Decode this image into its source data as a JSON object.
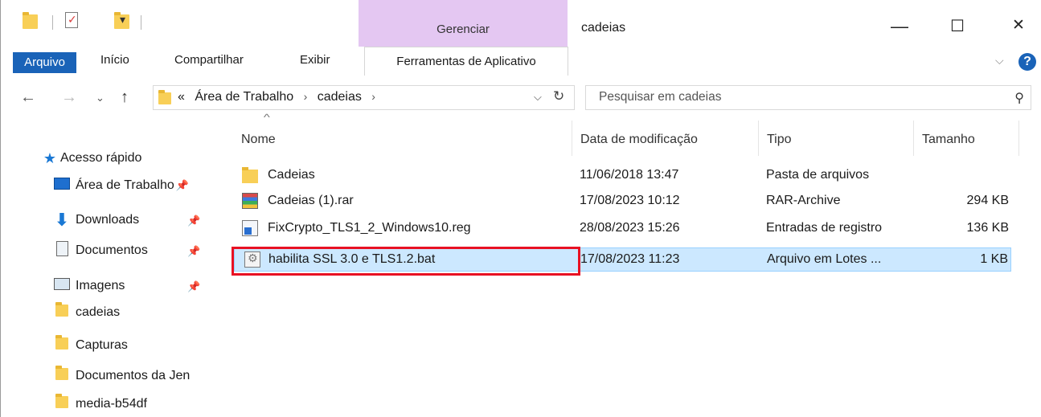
{
  "window": {
    "title": "cadeias",
    "context_tab_group": "Gerenciar",
    "controls": {
      "minimize": "—",
      "maximize": "☐",
      "close": "✕"
    }
  },
  "ribbon": {
    "tabs": [
      "Arquivo",
      "Início",
      "Compartilhar",
      "Exibir",
      "Ferramentas de Aplicativo"
    ],
    "help": "?"
  },
  "address": {
    "prefix": "«",
    "crumbs": [
      "Área de Trabalho",
      "cadeias"
    ],
    "separator": "›"
  },
  "search": {
    "placeholder": "Pesquisar em cadeias"
  },
  "sidebar": {
    "quick_access": "Acesso rápido",
    "items": [
      {
        "label": "Área de Trabalho",
        "icon": "desktop-icon",
        "pinned": true
      },
      {
        "label": "Downloads",
        "icon": "download-arrow-icon",
        "pinned": true
      },
      {
        "label": "Documentos",
        "icon": "documents-icon",
        "pinned": true
      },
      {
        "label": "Imagens",
        "icon": "pictures-icon",
        "pinned": true
      },
      {
        "label": "cadeias",
        "icon": "folder-icon",
        "pinned": false
      },
      {
        "label": "Capturas",
        "icon": "folder-icon",
        "pinned": false
      },
      {
        "label": "Documentos da Jen",
        "icon": "folder-icon",
        "pinned": false
      },
      {
        "label": "media-b54df",
        "icon": "folder-icon",
        "pinned": false
      }
    ]
  },
  "columns": [
    "Nome",
    "Data de modificação",
    "Tipo",
    "Tamanho"
  ],
  "files": [
    {
      "name": "Cadeias",
      "date": "11/06/2018 13:47",
      "type": "Pasta de arquivos",
      "size": "",
      "icon": "folder"
    },
    {
      "name": "Cadeias (1).rar",
      "date": "17/08/2023 10:12",
      "type": "RAR-Archive",
      "size": "294 KB",
      "icon": "rar"
    },
    {
      "name": "FixCrypto_TLS1_2_Windows10.reg",
      "date": "28/08/2023 15:26",
      "type": "Entradas de registro",
      "size": "136 KB",
      "icon": "reg"
    },
    {
      "name": "habilita SSL 3.0 e TLS1.2.bat",
      "date": "17/08/2023 11:23",
      "type": "Arquivo em Lotes ...",
      "size": "1 KB",
      "icon": "bat",
      "selected": true
    }
  ],
  "colors": {
    "accent": "#1a63b8",
    "context_tab": "#e4c7f2",
    "selection": "#cce8ff",
    "highlight_box": "#e81123"
  }
}
